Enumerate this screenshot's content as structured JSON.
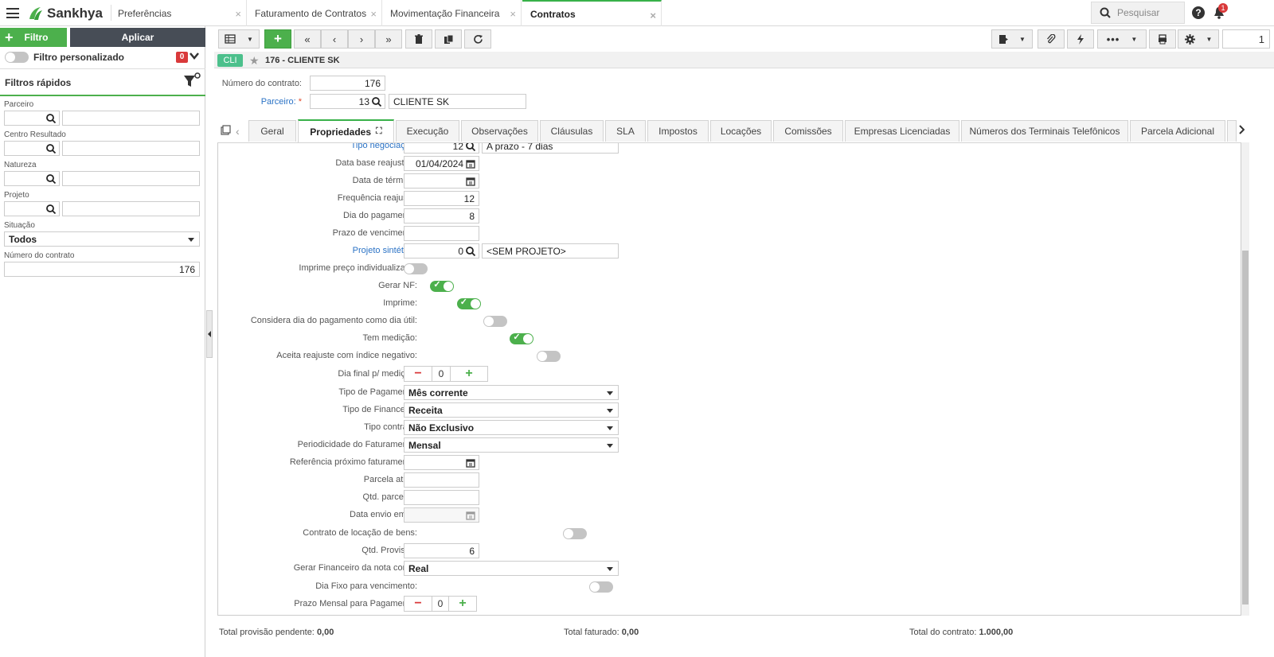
{
  "app": {
    "brand": "Sankhya"
  },
  "top_tabs": [
    {
      "label": "Preferências"
    },
    {
      "label": "Faturamento de Contratos"
    },
    {
      "label": "Movimentação Financeira"
    },
    {
      "label": "Contratos"
    }
  ],
  "search": {
    "placeholder": "Pesquisar"
  },
  "notifications": {
    "count": "1"
  },
  "left": {
    "filtro_btn": "Filtro",
    "aplicar_btn": "Aplicar",
    "custom_filter_label": "Filtro personalizado",
    "custom_filter_count": "0",
    "quick_filters_title": "Filtros rápidos",
    "fields": [
      {
        "label": "Parceiro"
      },
      {
        "label": "Centro Resultado"
      },
      {
        "label": "Natureza"
      },
      {
        "label": "Projeto"
      }
    ],
    "situacao_label": "Situação",
    "situacao_value": "Todos",
    "numero_label": "Número do contrato",
    "numero_value": "176"
  },
  "main": {
    "page_number": "1",
    "badge": "CLI",
    "record_title": "176 - CLIENTE SK",
    "numero_label": "Número do contrato:",
    "numero_value": "176",
    "parceiro_label": "Parceiro:",
    "parceiro_code": "13",
    "parceiro_name": "CLIENTE SK",
    "tabs": [
      {
        "label": "Geral"
      },
      {
        "label": "Propriedades"
      },
      {
        "label": "Execução"
      },
      {
        "label": "Observações"
      },
      {
        "label": "Cláusulas"
      },
      {
        "label": "SLA"
      },
      {
        "label": "Impostos"
      },
      {
        "label": "Locações"
      },
      {
        "label": "Comissões"
      },
      {
        "label": "Empresas Licenciadas"
      },
      {
        "label": "Números dos Terminais Telefônicos"
      },
      {
        "label": "Parcela Adicional"
      }
    ],
    "fields": {
      "tipo_negociacao": {
        "label": "Tipo negociação:",
        "code": "12",
        "desc": "A prazo - 7 dias"
      },
      "data_base_reajuste": {
        "label": "Data base reajuste:",
        "value": "01/04/2024"
      },
      "data_termino": {
        "label": "Data de término:",
        "value": ""
      },
      "frequencia_reajuste": {
        "label": "Frequência reajuste:",
        "value": "12"
      },
      "dia_pagamento": {
        "label": "Dia do pagamento:",
        "value": "8"
      },
      "prazo_vencimento": {
        "label": "Prazo de vencimento:",
        "value": ""
      },
      "projeto_sintetico": {
        "label": "Projeto sintético:",
        "code": "0",
        "desc": "<SEM PROJETO>"
      },
      "imprime_preco": {
        "label": "Imprime preço individualizado:",
        "on": false
      },
      "gerar_nf": {
        "label": "Gerar NF:",
        "on": true
      },
      "imprime": {
        "label": "Imprime:",
        "on": true
      },
      "considera_dia": {
        "label": "Considera dia do pagamento como dia útil:",
        "on": false
      },
      "tem_medicao": {
        "label": "Tem medição:",
        "on": true
      },
      "aceita_reajuste": {
        "label": "Aceita reajuste com índice negativo:",
        "on": false
      },
      "dia_final_medicao": {
        "label": "Dia final p/ medição:",
        "value": "0"
      },
      "tipo_pagamento": {
        "label": "Tipo de Pagamento:",
        "value": "Mês corrente"
      },
      "tipo_financeiro": {
        "label": "Tipo de Financeiro:",
        "value": "Receita"
      },
      "tipo_contrato": {
        "label": "Tipo contrato:",
        "value": "Não Exclusivo"
      },
      "periodicidade": {
        "label": "Periodicidade do Faturamento:",
        "value": "Mensal"
      },
      "referencia_proximo": {
        "label": "Referência próximo faturamento:",
        "value": ""
      },
      "parcela_atual": {
        "label": "Parcela atual:",
        "value": ""
      },
      "qtd_parcelas": {
        "label": "Qtd. parcelas:",
        "value": ""
      },
      "data_envio_email": {
        "label": "Data envio email:",
        "value": ""
      },
      "contrato_locacao": {
        "label": "Contrato de locação de bens:",
        "on": false
      },
      "qtd_provisao": {
        "label": "Qtd. Provisão:",
        "value": "6"
      },
      "gerar_financeiro": {
        "label": "Gerar Financeiro da nota como:",
        "value": "Real"
      },
      "dia_fixo": {
        "label": "Dia Fixo para vencimento:",
        "on": false
      },
      "prazo_mensal": {
        "label": "Prazo Mensal para Pagamento:",
        "value": "0"
      }
    },
    "footer": {
      "provisao_label": "Total provisão pendente:",
      "provisao_value": "0,00",
      "faturado_label": "Total faturado:",
      "faturado_value": "0,00",
      "contrato_label": "Total do contrato:",
      "contrato_value": "1.000,00"
    }
  },
  "colors": {
    "accent": "#4cb04c",
    "dark": "#474d56",
    "link": "#2a72c5",
    "badge_red": "#d9393a"
  }
}
